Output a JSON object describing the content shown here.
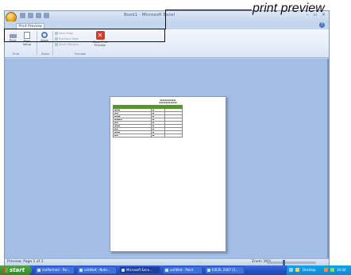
{
  "annotation": {
    "label": "print preview"
  },
  "window": {
    "title": "Book1 - Microsoft Excel",
    "controls": [
      "–",
      "▫",
      "×"
    ]
  },
  "tabs": [
    {
      "label": "Print Preview"
    }
  ],
  "ribbon": {
    "print": {
      "label": "Print"
    },
    "page_setup": {
      "label": "Page Setup"
    },
    "zoom": {
      "label": "Zoom"
    },
    "next_page": {
      "label": "Next Page"
    },
    "previous_page": {
      "label": "Previous Page"
    },
    "show_margins": {
      "label": "Show Margins"
    },
    "close_preview": {
      "label": "Close Print Preview"
    },
    "groups": {
      "print": "Print",
      "zoom": "Zoom",
      "preview": "Preview"
    }
  },
  "status": {
    "text": "Preview: Page 1 of 1",
    "zoom": "Zoom 36%"
  },
  "taskbar": {
    "start": "start",
    "tasks": [
      {
        "label": "malformed - Pai..."
      },
      {
        "label": "untitled - Note..."
      },
      {
        "label": "Microsoft Exce..."
      },
      {
        "label": "untitled - Paint"
      },
      {
        "label": "EXCEL 2007 Cl..."
      }
    ],
    "tray": {
      "desktop": "Desktop",
      "time": "10:44"
    }
  }
}
